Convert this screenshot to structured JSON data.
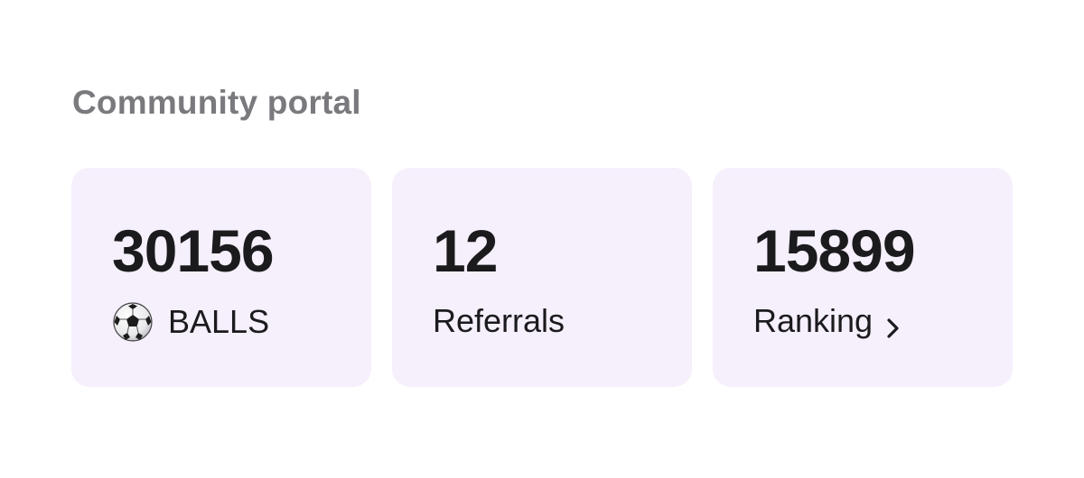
{
  "section": {
    "title": "Community portal"
  },
  "stats": {
    "balls": {
      "value": "30156",
      "label": "BALLS",
      "icon": "soccer-ball-icon"
    },
    "referrals": {
      "value": "12",
      "label": "Referrals"
    },
    "ranking": {
      "value": "15899",
      "label": "Ranking",
      "icon": "chevron-right-icon"
    }
  },
  "colors": {
    "card_background": "#f6effc",
    "title_text": "#7a7a7e",
    "primary_text": "#1b1b1d"
  }
}
